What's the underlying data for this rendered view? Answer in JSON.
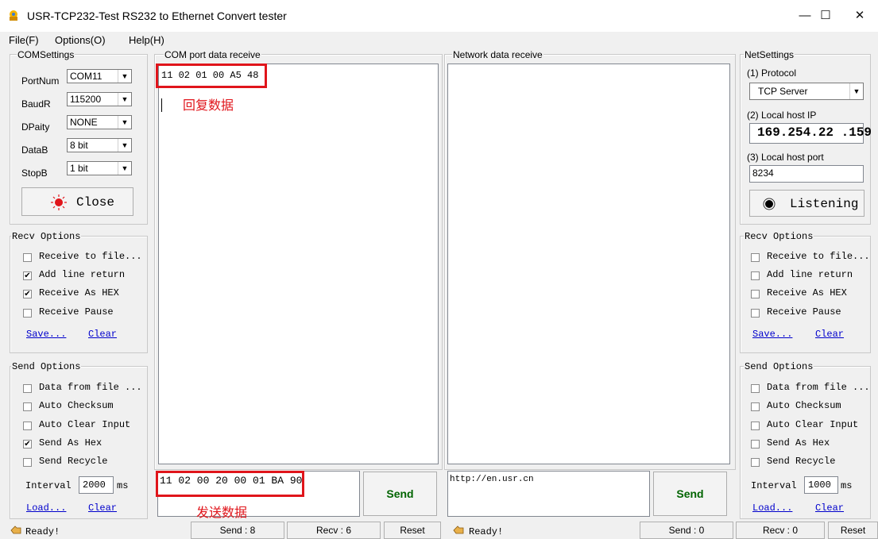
{
  "window": {
    "title": "USR-TCP232-Test  RS232 to Ethernet Convert tester",
    "minimize": "—",
    "maximize": "☐",
    "close": "✕"
  },
  "menu": [
    "File(F)",
    "Options(O)",
    "Help(H)"
  ],
  "com_settings": {
    "title": "COMSettings",
    "fields": [
      {
        "label": "PortNum",
        "value": "COM11"
      },
      {
        "label": "BaudR",
        "value": "115200"
      },
      {
        "label": "DPaity",
        "value": "NONE"
      },
      {
        "label": "DataB",
        "value": "8 bit"
      },
      {
        "label": "StopB",
        "value": "1 bit"
      }
    ],
    "button": "Close"
  },
  "left_recv": {
    "title": "Recv Options",
    "options": [
      {
        "label": "Receive to file...",
        "checked": false
      },
      {
        "label": "Add line return",
        "checked": true
      },
      {
        "label": "Receive As HEX",
        "checked": true
      },
      {
        "label": "Receive Pause",
        "checked": false
      }
    ],
    "save": "Save...",
    "clear": "Clear"
  },
  "left_send": {
    "title": "Send Options",
    "options": [
      {
        "label": "Data from file ...",
        "checked": false
      },
      {
        "label": "Auto Checksum",
        "checked": false
      },
      {
        "label": "Auto Clear Input",
        "checked": false
      },
      {
        "label": "Send As Hex",
        "checked": true
      },
      {
        "label": "Send Recycle",
        "checked": false
      }
    ],
    "interval_label": "Interval",
    "interval_value": "2000",
    "interval_unit": "ms",
    "load": "Load...",
    "clear": "Clear"
  },
  "com_receive": {
    "title": "COM port data receive",
    "content": "11 02 01 00 A5 48",
    "annotation": "回复数据"
  },
  "com_send": {
    "content": "11 02 00 20 00 01 BA 90",
    "annotation": "发送数据",
    "button": "Send"
  },
  "net_receive": {
    "title": "Network data receive"
  },
  "net_send": {
    "content": "http://en.usr.cn",
    "button": "Send"
  },
  "net_settings": {
    "title": "NetSettings",
    "protocol_label": "(1) Protocol",
    "protocol_value": "TCP Server",
    "ip_label": "(2) Local host IP",
    "ip_value": "169.254.22 .159",
    "port_label": "(3) Local host port",
    "port_value": "8234",
    "button": "Listening"
  },
  "right_recv": {
    "title": "Recv Options",
    "options": [
      {
        "label": "Receive to file...",
        "checked": false
      },
      {
        "label": "Add line return",
        "checked": false
      },
      {
        "label": "Receive As HEX",
        "checked": false
      },
      {
        "label": "Receive Pause",
        "checked": false
      }
    ],
    "save": "Save...",
    "clear": "Clear"
  },
  "right_send": {
    "title": "Send Options",
    "options": [
      {
        "label": "Data from file ...",
        "checked": false
      },
      {
        "label": "Auto Checksum",
        "checked": false
      },
      {
        "label": "Auto Clear Input",
        "checked": false
      },
      {
        "label": "Send As Hex",
        "checked": false
      },
      {
        "label": "Send Recycle",
        "checked": false
      }
    ],
    "interval_label": "Interval",
    "interval_value": "1000",
    "interval_unit": "ms",
    "load": "Load...",
    "clear": "Clear"
  },
  "status": {
    "left_ready": "Ready!",
    "left_send": "Send : 8",
    "left_recv": "Recv : 6",
    "left_reset": "Reset",
    "right_ready": "Ready!",
    "right_send": "Send : 0",
    "right_recv": "Recv : 0",
    "right_reset": "Reset"
  },
  "colors": {
    "annotation": "#e0151b",
    "link": "#0000cc"
  }
}
